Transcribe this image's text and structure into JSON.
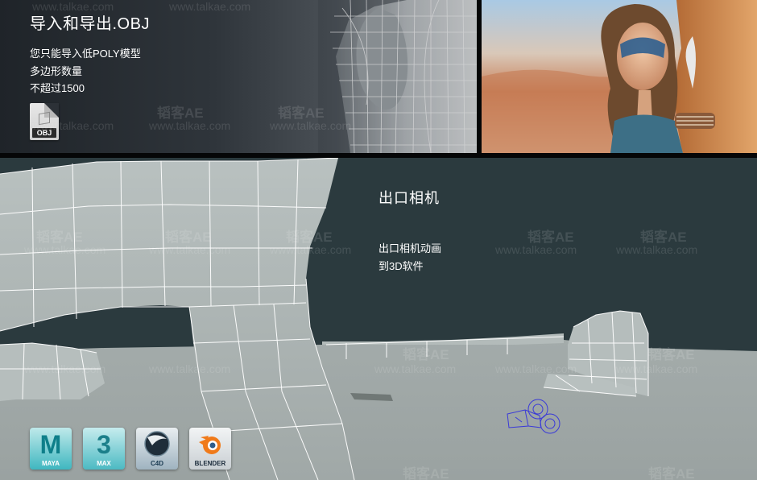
{
  "obj_section": {
    "title": "导入和导出.OBJ",
    "lines": [
      "您只能导入低POLY模型",
      "多边形数量",
      "不超过1500"
    ],
    "file_icon_label": "OBJ"
  },
  "camera_section": {
    "title": "出口相机",
    "lines": [
      "出口相机动画",
      "到3D软件"
    ]
  },
  "software_icons": [
    {
      "name": "maya-icon",
      "glyph": "M",
      "label": "MAYA"
    },
    {
      "name": "3dsmax-icon",
      "glyph": "3",
      "label": "MAX"
    },
    {
      "name": "cinema4d-icon",
      "glyph": "",
      "label": "C4D"
    },
    {
      "name": "blender-icon",
      "glyph": "",
      "label": "BLENDER"
    }
  ],
  "watermark": {
    "brand": "韬客AE",
    "url": "www.talkae.com"
  },
  "colors": {
    "panel_dark": "#2b3a3e",
    "ground": "#a4acab",
    "wire": "#ffffff",
    "camera_gizmo": "#3a3ad8"
  }
}
